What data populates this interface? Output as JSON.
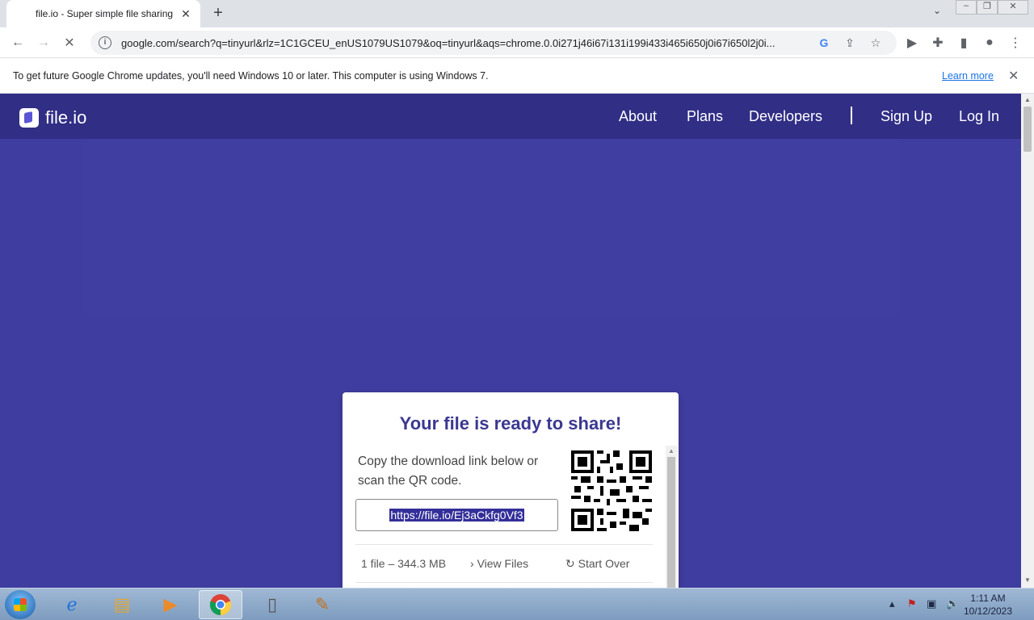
{
  "browser": {
    "tab_title": "file.io - Super simple file sharing",
    "new_tab": "+",
    "url": "google.com/search?q=tinyurl&rlz=1C1GCEU_enUS1079US1079&oq=tinyurl&aqs=chrome.0.0i271j46i67i131i199i433i465i650j0i67i650l2j0i...",
    "infobar_text": "To get future Google Chrome updates, you'll need Windows 10 or later. This computer is using Windows 7.",
    "infobar_link": "Learn more"
  },
  "site": {
    "logo": "file.io",
    "nav": {
      "about": "About",
      "plans": "Plans",
      "developers": "Developers",
      "signup": "Sign Up",
      "login": "Log In"
    }
  },
  "card": {
    "title": "Your file is ready to share!",
    "desc": "Copy the download link below or scan the QR code.",
    "link": "https://file.io/Ej3aCkfg0Vf3",
    "file_info": "1 file – 344.3 MB",
    "view_files": "View Files",
    "start_over": "Start Over"
  },
  "taskbar": {
    "time": "1:11 AM",
    "date": "10/12/2023"
  },
  "colors": {
    "brand": "#3f3d9f",
    "header": "#312e86",
    "title": "#3b3891"
  }
}
